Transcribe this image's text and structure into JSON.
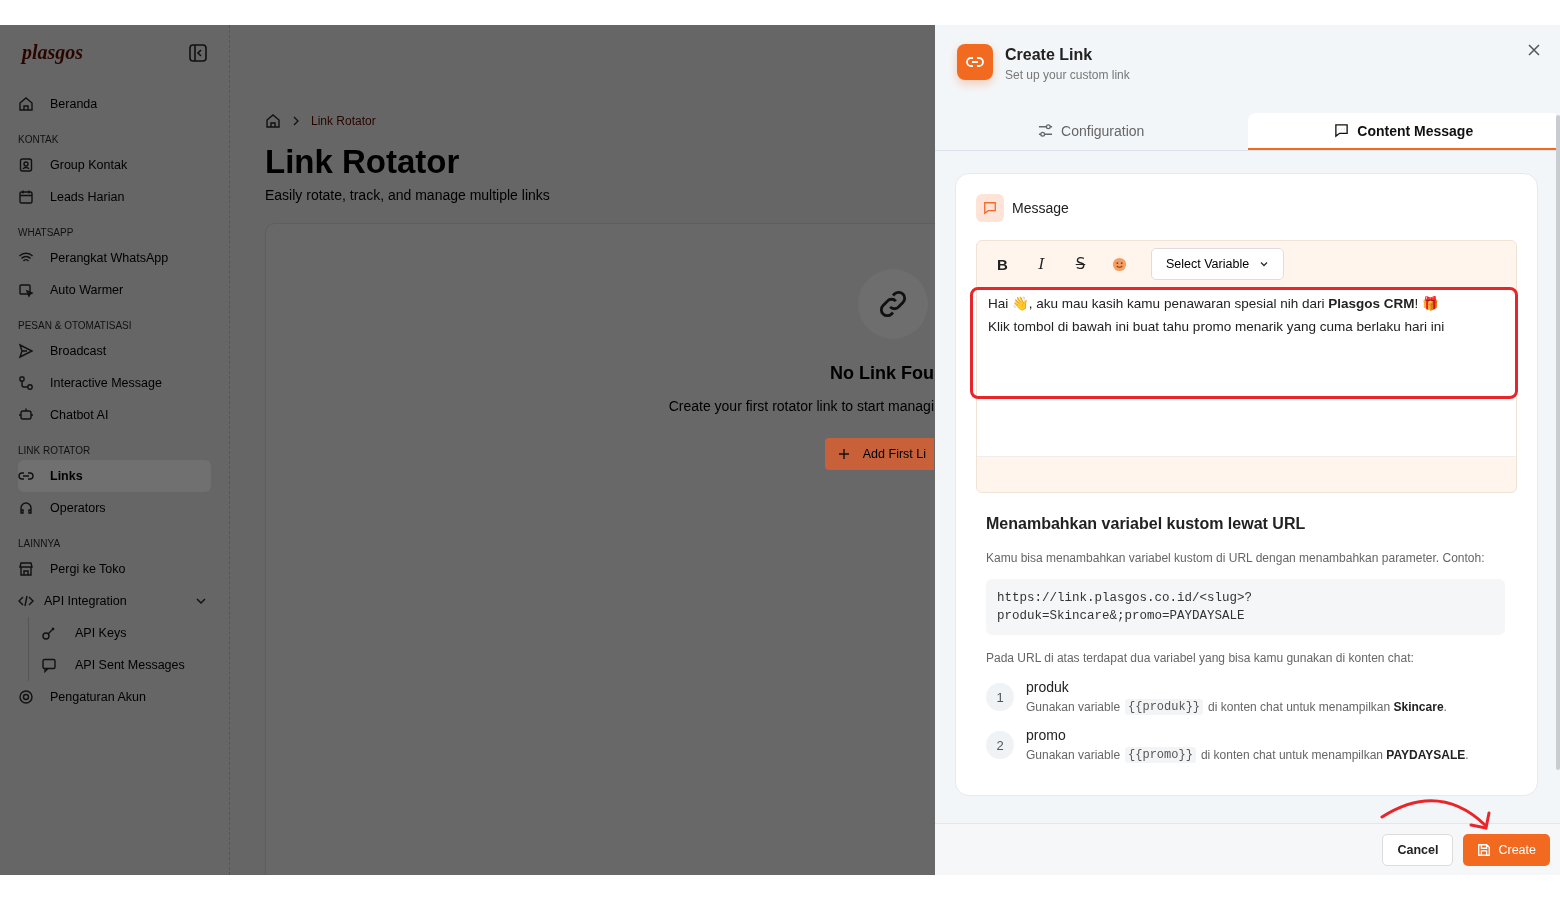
{
  "sidebar": {
    "logo": "plasgos",
    "sections": [
      {
        "items": [
          {
            "label": "Beranda",
            "selected": false
          }
        ]
      },
      {
        "heading": "KONTAK",
        "items": [
          {
            "label": "Group Kontak",
            "selected": false
          },
          {
            "label": "Leads Harian",
            "selected": false
          }
        ]
      },
      {
        "heading": "WHATSAPP",
        "items": [
          {
            "label": "Perangkat WhatsApp",
            "selected": false
          },
          {
            "label": "Auto Warmer",
            "selected": false
          }
        ]
      },
      {
        "heading": "PESAN & OTOMATISASI",
        "items": [
          {
            "label": "Broadcast",
            "selected": false
          },
          {
            "label": "Interactive Message",
            "selected": false
          },
          {
            "label": "Chatbot AI",
            "selected": false
          }
        ]
      },
      {
        "heading": "LINK ROTATOR",
        "items": [
          {
            "label": "Links",
            "selected": true
          },
          {
            "label": "Operators",
            "selected": false
          }
        ]
      },
      {
        "heading": "LAINNYA",
        "items": [
          {
            "label": "Pergi ke Toko",
            "selected": false
          },
          {
            "label": "API Integration",
            "selected": false,
            "expanded": true,
            "children": [
              {
                "label": "API Keys",
                "selected": false
              },
              {
                "label": "API Sent Messages",
                "selected": false
              }
            ]
          },
          {
            "label": "Pengaturan Akun",
            "selected": false
          }
        ]
      }
    ]
  },
  "main": {
    "breadcrumb": "Link Rotator",
    "title": "Link Rotator",
    "subtitle": "Easily rotate, track, and manage multiple links",
    "empty_state": {
      "title": "No Link Fou",
      "text": "Create your first rotator link to start managi",
      "button": "Add First Li"
    }
  },
  "drawer": {
    "title": "Create Link",
    "subtitle": "Set up your custom link",
    "tabs": [
      {
        "label": "Configuration",
        "selected": false
      },
      {
        "label": "Content Message",
        "selected": true
      }
    ],
    "message": {
      "heading": "Message",
      "toolbar": [
        {
          "kind": "bold",
          "label": "B"
        },
        {
          "kind": "italic",
          "label": "I"
        },
        {
          "kind": "strike",
          "label": "S"
        },
        {
          "kind": "emoji"
        }
      ],
      "select": "Select Variable",
      "lines": [
        "Hai 👋, aku mau kasih kamu penawaran spesial nih dari **Plasgos CRM**! 🎁",
        "Klik tombol di bawah ini buat tahu promo menarik yang cuma berlaku hari ini"
      ]
    },
    "info": {
      "heading": "Menambahkan variabel kustom lewat URL",
      "text": "Kamu bisa menambahkan variabel kustom di URL dengan menambahkan parameter. Contoh:",
      "code": [
        "https://link.plasgos.co.id/<slug>?",
        "produk=Skincare&;promo=PAYDAYSALE"
      ],
      "text2": "Pada URL di atas terdapat dua variabel yang bisa kamu gunakan di konten chat:",
      "variables": [
        {
          "number": "1",
          "name": "produk",
          "before": "Gunakan variable",
          "code": "{{produk}}",
          "after": "di konten chat untuk menampilkan **Skincare**."
        },
        {
          "number": "2",
          "name": "promo",
          "before": "Gunakan variable",
          "code": "{{promo}}",
          "after": "di konten chat untuk menampilkan **PAYDAYSALE**."
        }
      ]
    },
    "buttons": {
      "cancel": "Cancel",
      "create": "Create"
    }
  }
}
